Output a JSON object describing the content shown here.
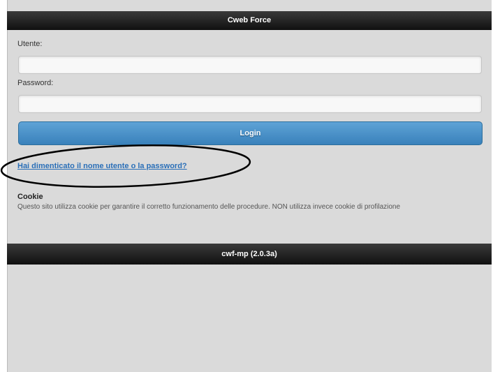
{
  "header": {
    "title": "Cweb Force"
  },
  "login_form": {
    "username_label": "Utente:",
    "username_value": "",
    "password_label": "Password:",
    "password_value": "",
    "login_button": "Login",
    "forgot_link": "Hai dimenticato il nome utente o la password?"
  },
  "cookie": {
    "title": "Cookie",
    "text": "Questo sito utilizza cookie per garantire il corretto funzionamento delle procedure. NON utilizza invece cookie di profilazione"
  },
  "footer": {
    "version": "cwf-mp (2.0.3a)"
  }
}
